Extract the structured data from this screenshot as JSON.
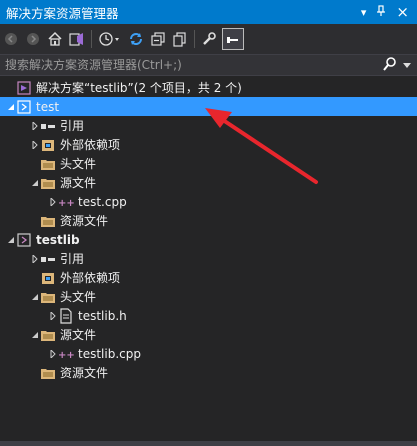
{
  "window": {
    "title": "解决方案资源管理器",
    "pin_glyph": "▾",
    "pin2_glyph": "‧",
    "close_glyph": "×"
  },
  "toolbar": {
    "buttons": [
      "back-icon",
      "forward-icon",
      "home-icon",
      "vs-switch-icon",
      "history-icon",
      "sync-icon",
      "collapse-all-icon",
      "show-all-files-icon",
      "properties-icon",
      "preview-icon"
    ]
  },
  "search": {
    "placeholder": "搜索解决方案资源管理器(Ctrl+;)"
  },
  "tree": {
    "solution_label": "解决方案“testlib”(2 个项目，共 2 个)",
    "items": [
      {
        "label": "test"
      },
      {
        "label": "引用"
      },
      {
        "label": "外部依赖项"
      },
      {
        "label": "头文件"
      },
      {
        "label": "源文件"
      },
      {
        "label": "test.cpp"
      },
      {
        "label": "资源文件"
      },
      {
        "label": "testlib"
      },
      {
        "label": "引用"
      },
      {
        "label": "外部依赖项"
      },
      {
        "label": "头文件"
      },
      {
        "label": "testlib.h"
      },
      {
        "label": "源文件"
      },
      {
        "label": "testlib.cpp"
      },
      {
        "label": "资源文件"
      }
    ]
  },
  "colors": {
    "titlebar": "#007acc",
    "selection": "#3399ff",
    "background": "#252526",
    "arrow": "#e8262d",
    "folder": "#dcb67a",
    "project": "#c586c0"
  }
}
